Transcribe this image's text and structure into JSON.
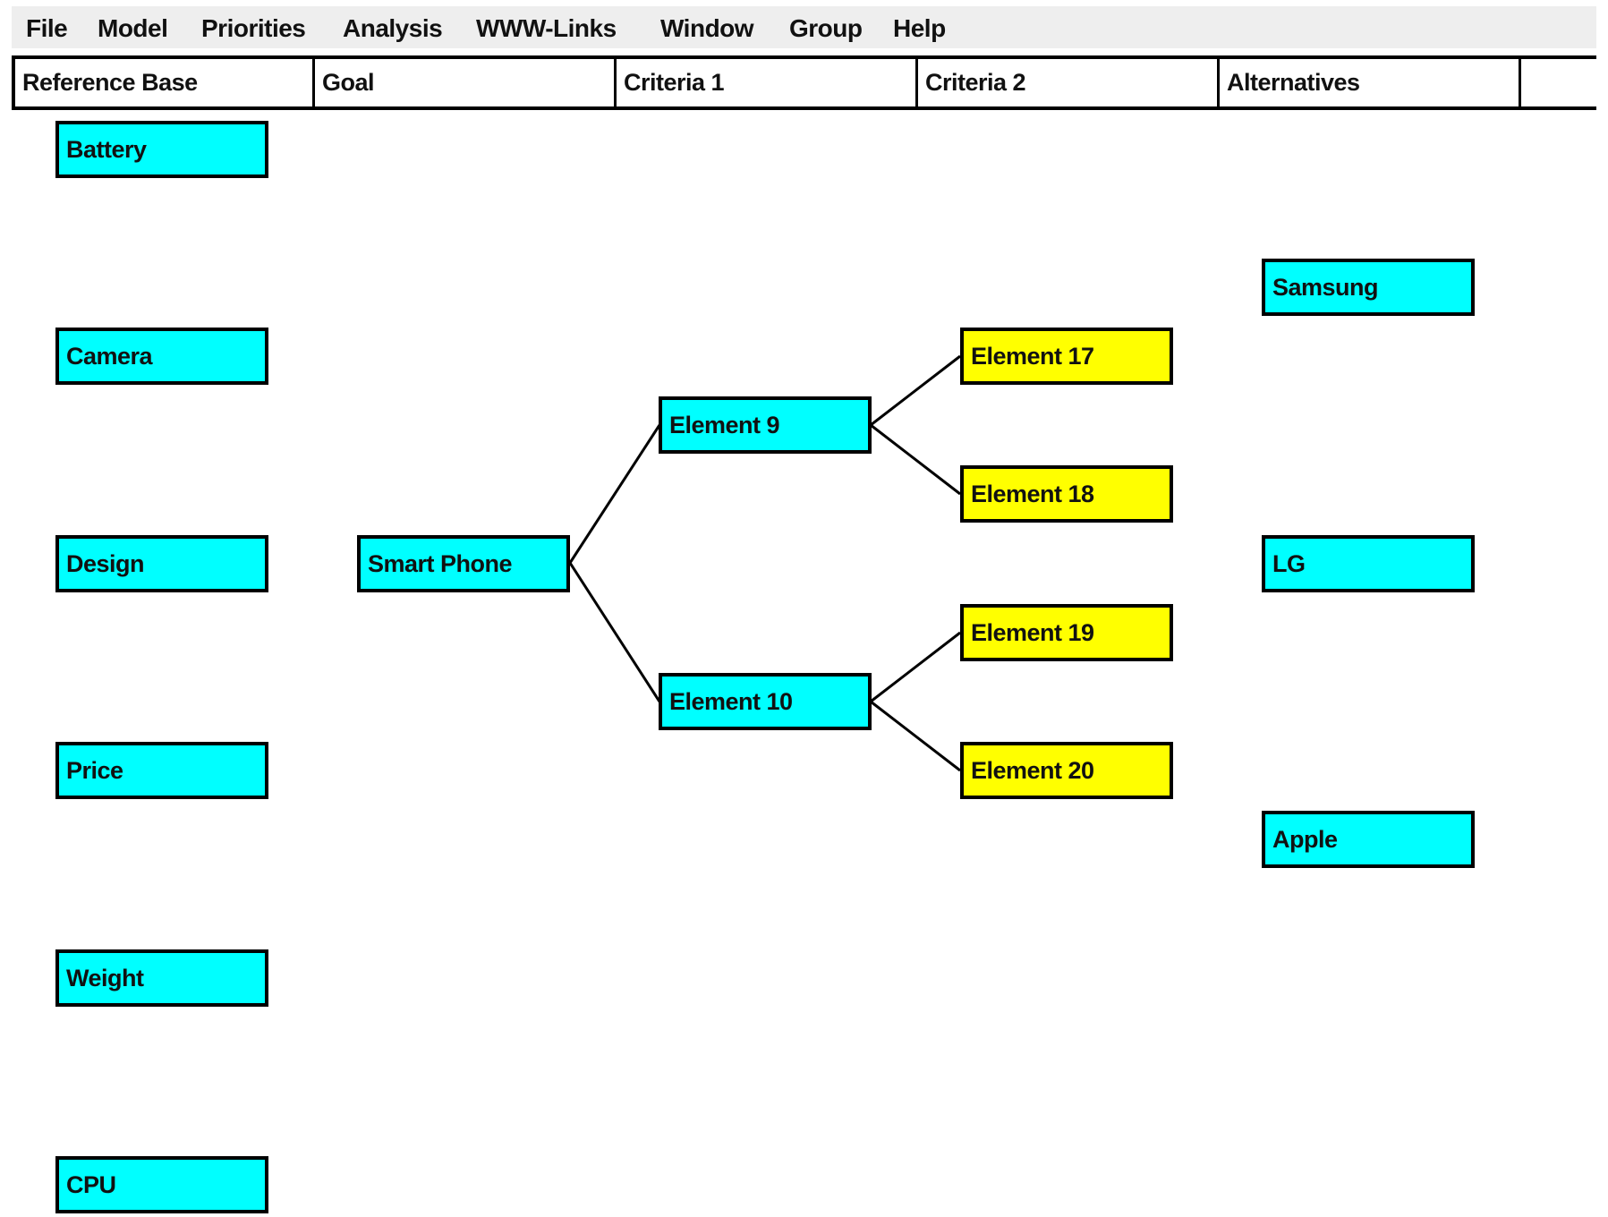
{
  "menu": {
    "items": [
      "File",
      "Model",
      "Priorities",
      "Analysis",
      "WWW-Links",
      "Window",
      "Group",
      "Help"
    ]
  },
  "columns": [
    "Reference Base",
    "Goal",
    "Criteria 1",
    "Criteria 2",
    "Alternatives",
    ""
  ],
  "colors": {
    "node_primary": "#00FFFF",
    "node_subcriteria": "#FFFF00",
    "menubar_bg": "#EEEEEE",
    "line": "#000000"
  },
  "reference_base": [
    "Battery",
    "Camera",
    "Design",
    "Price",
    "Weight",
    "CPU"
  ],
  "goal": "Smart Phone",
  "criteria1": [
    "Element 9",
    "Element 10"
  ],
  "criteria2": [
    "Element 17",
    "Element 18",
    "Element 19",
    "Element 20"
  ],
  "alternatives": [
    "Samsung",
    "LG",
    "Apple"
  ],
  "links": [
    {
      "from": "Smart Phone",
      "to": "Element 9"
    },
    {
      "from": "Smart Phone",
      "to": "Element 10"
    },
    {
      "from": "Element 9",
      "to": "Element 17"
    },
    {
      "from": "Element 9",
      "to": "Element 18"
    },
    {
      "from": "Element 10",
      "to": "Element 19"
    },
    {
      "from": "Element 10",
      "to": "Element 20"
    }
  ]
}
